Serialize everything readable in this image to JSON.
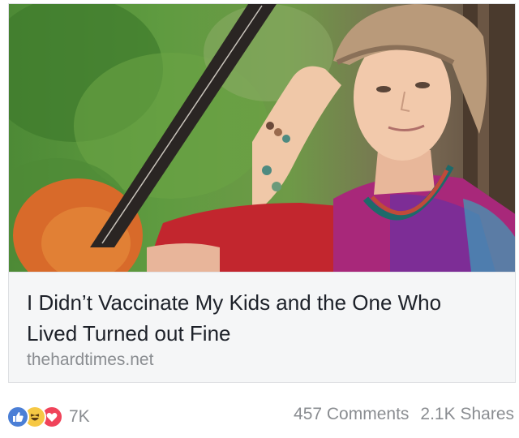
{
  "link_card": {
    "headline": "I Didn’t Vaccinate My Kids and the One Who Lived Turned out Fine",
    "domain": "thehardtimes.net"
  },
  "post_footer": {
    "reactions": [
      {
        "icon": "like-icon",
        "color": "#4b7fd6"
      },
      {
        "icon": "haha-icon",
        "color": "#f6c844"
      },
      {
        "icon": "love-icon",
        "color": "#f0435a"
      }
    ],
    "reaction_count": "7K",
    "comments": "457 Comments",
    "shares": "2.1K Shares"
  }
}
